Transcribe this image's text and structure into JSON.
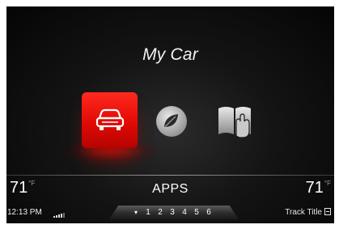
{
  "screen": {
    "title": "My Car"
  },
  "apps": [
    {
      "name": "My Car",
      "icon": "car-icon",
      "selected": true,
      "color": "#e10a05"
    },
    {
      "name": "Efficiency",
      "icon": "leaf-icon",
      "selected": false
    },
    {
      "name": "Manual",
      "icon": "book-hand-icon",
      "selected": false
    }
  ],
  "status_bar": {
    "temp_left": "71",
    "temp_left_unit": "°F",
    "temp_right": "71",
    "temp_right_unit": "°F",
    "center_label": "APPS"
  },
  "bottom_bar": {
    "clock": "12:13 PM",
    "signal_icon": "signal-bars-icon",
    "preset_arrow": "▾",
    "presets": [
      "1",
      "2",
      "3",
      "4",
      "5",
      "6"
    ],
    "track_title": "Track Title"
  }
}
